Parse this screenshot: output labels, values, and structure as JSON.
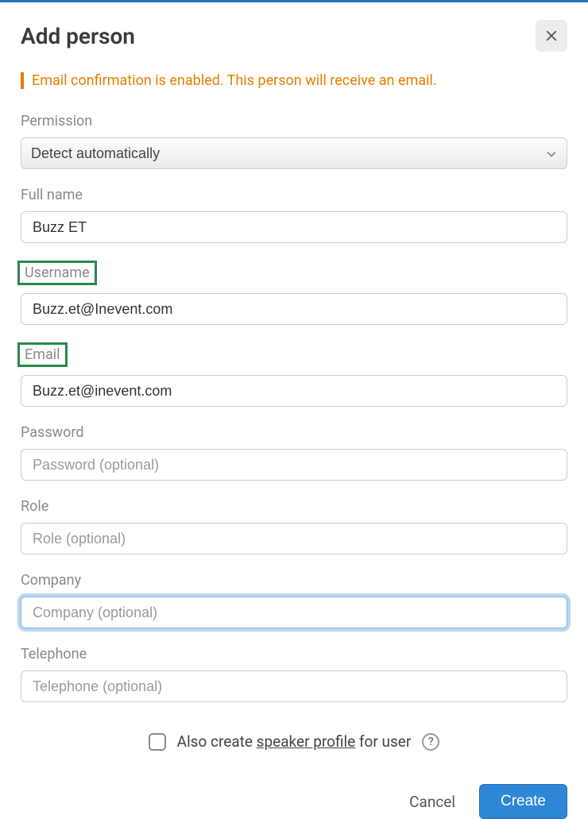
{
  "header": {
    "title": "Add person"
  },
  "notice": "Email confirmation is enabled. This person will receive an email.",
  "fields": {
    "permission": {
      "label": "Permission",
      "value": "Detect automatically"
    },
    "full_name": {
      "label": "Full name",
      "value": "Buzz ET"
    },
    "username": {
      "label": "Username",
      "value": "Buzz.et@Inevent.com"
    },
    "email": {
      "label": "Email",
      "value": "Buzz.et@inevent.com"
    },
    "password": {
      "label": "Password",
      "placeholder": "Password (optional)",
      "value": ""
    },
    "role": {
      "label": "Role",
      "placeholder": "Role (optional)",
      "value": ""
    },
    "company": {
      "label": "Company",
      "placeholder": "Company (optional)",
      "value": ""
    },
    "telephone": {
      "label": "Telephone",
      "placeholder": "Telephone (optional)",
      "value": ""
    }
  },
  "checkbox": {
    "prefix": "Also create ",
    "underlined": "speaker profile",
    "suffix": " for user"
  },
  "footer": {
    "cancel": "Cancel",
    "create": "Create"
  }
}
